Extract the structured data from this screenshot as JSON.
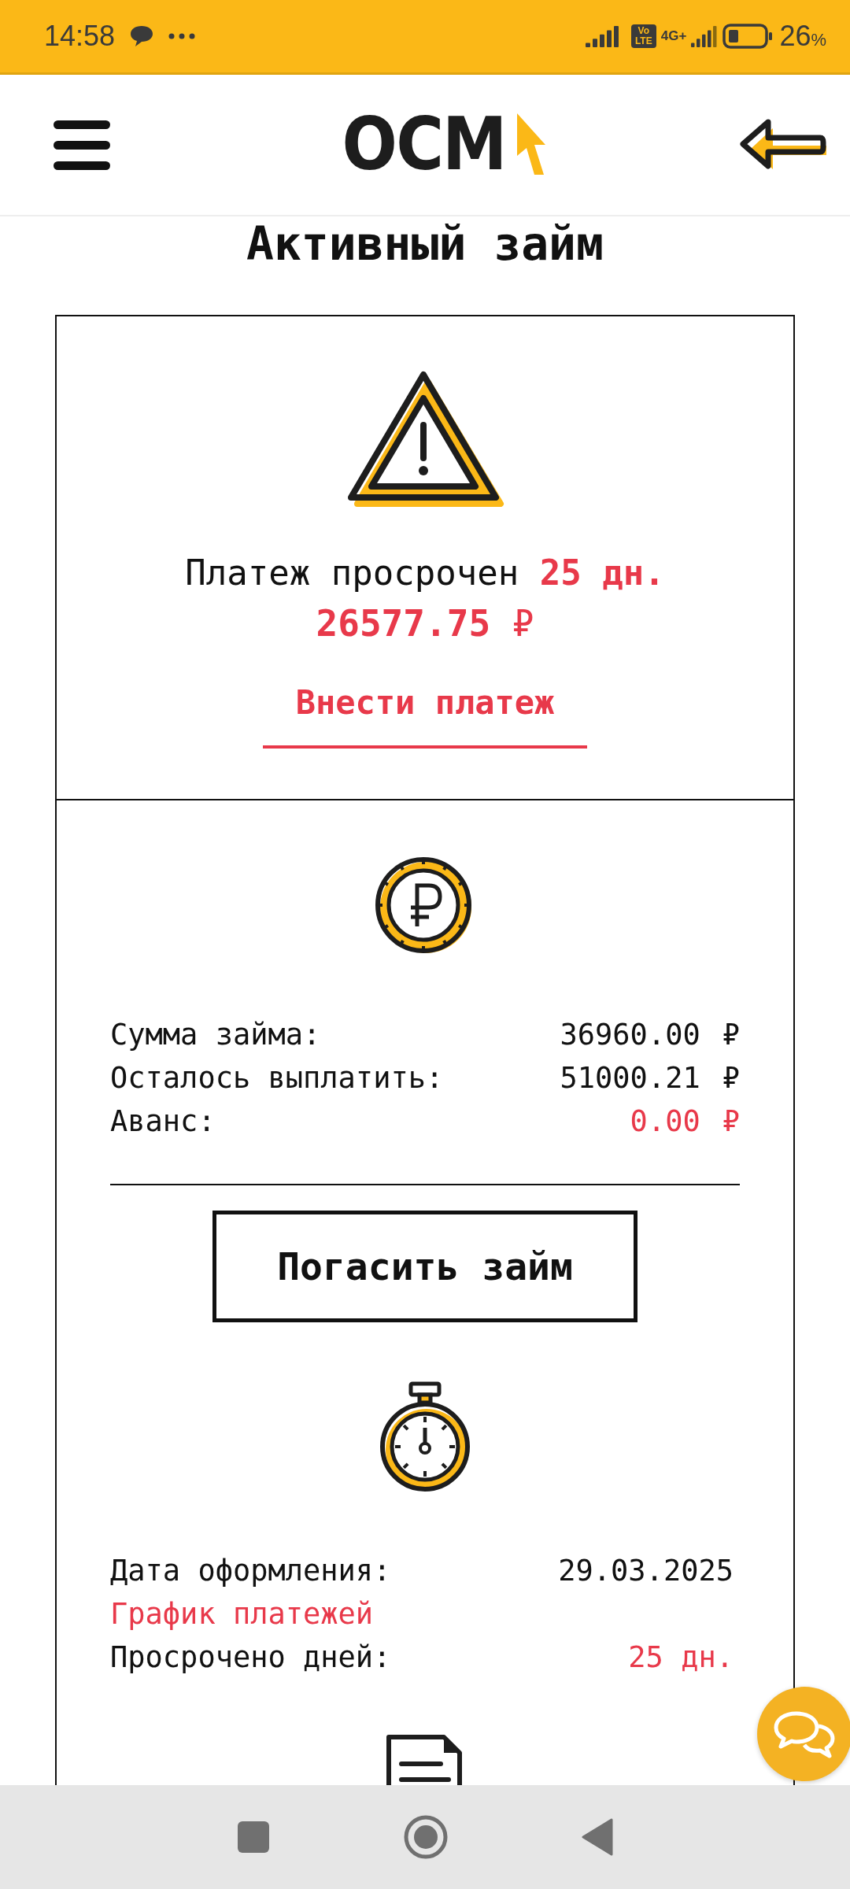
{
  "status_bar": {
    "time": "14:58",
    "volte": "Vo LTE",
    "network": "4G+",
    "battery": "26",
    "battery_unit": "%"
  },
  "header": {
    "logo": "ОСМ"
  },
  "title": "Активный займ",
  "overdue": {
    "message": "Платеж просрочен **25 дн.**",
    "amount": "**26577.75** ₽",
    "pay_link": "Внести платеж"
  },
  "summary": {
    "rows": [
      {
        "label": "Сумма займа:",
        "value": "36960.00",
        "currency": "₽",
        "accent": false
      },
      {
        "label": "Осталось выплатить:",
        "value": "51000.21",
        "currency": "₽",
        "accent": false
      },
      {
        "label": "Аванс:",
        "value": "0.00",
        "currency": "₽",
        "accent": true
      }
    ],
    "button": "Погасить займ"
  },
  "details": {
    "rows": [
      {
        "kind": "pair",
        "label": "Дата оформления:",
        "value": "29.03.2025",
        "accent": false
      },
      {
        "kind": "link",
        "label": "График платежей"
      },
      {
        "kind": "pair",
        "label": "Просрочено дней:",
        "value": "25 дн.",
        "accent": true
      }
    ]
  }
}
